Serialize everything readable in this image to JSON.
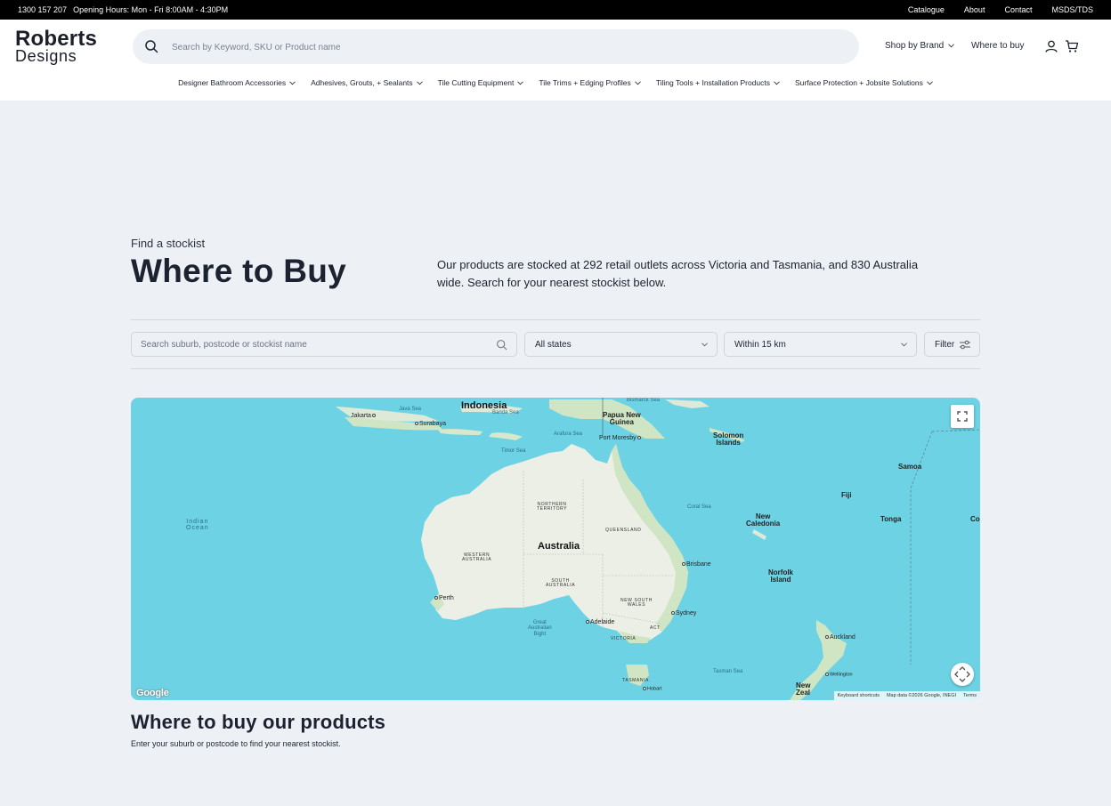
{
  "topbar": {
    "phone": "1300 157 207",
    "hours": "Opening Hours: Mon - Fri 8:00AM - 4:30PM",
    "links": [
      "Catalogue",
      "About",
      "Contact",
      "MSDS/TDS"
    ]
  },
  "header": {
    "logo_line1": "Roberts",
    "logo_line2": "Designs",
    "search_placeholder": "Search by Keyword, SKU or Product name",
    "shop_by_brand": "Shop by Brand",
    "where_to_buy": "Where to buy",
    "categories": [
      "Designer Bathroom Accessories",
      "Adhesives, Grouts, + Sealants",
      "Tile Cutting Equipment",
      "Tile Trims + Edging Profiles",
      "Tiling Tools + Installation Products",
      "Surface Protection + Jobsite Solutions"
    ]
  },
  "hero": {
    "eyebrow": "Find a stockist",
    "title": "Where to Buy",
    "intro": "Our products are stocked at 292 retail outlets across Victoria and Tasmania, and 830 Australia wide. Search for your nearest stockist below."
  },
  "filters": {
    "search_placeholder": "Search suburb, postcode or stockist name",
    "state": "All states",
    "radius": "Within 15 km",
    "filter_label": "Filter"
  },
  "map": {
    "labels": {
      "indonesia": "Indonesia",
      "jakarta": "Jakarta",
      "java_sea": "Java Sea",
      "banda_sea": "Banda Sea",
      "surabaya": "Surabaya",
      "bismarck": "Bismarck Sea",
      "png": "Papua New\nGuinea",
      "port_moresby": "Port Moresby",
      "arafura": "Arafura Sea",
      "timor": "Timor Sea",
      "solomon": "Solomon\nIslands",
      "samoa": "Samoa",
      "fiji": "Fiji",
      "tonga": "Tonga",
      "co": "Co",
      "new_caledonia": "New\nCaledonia",
      "coral_sea": "Coral Sea",
      "indian_ocean": "Indian\nOcean",
      "northern_territory": "NORTHERN\nTERRITORY",
      "queensland": "QUEENSLAND",
      "australia": "Australia",
      "western_australia": "WESTERN\nAUSTRALIA",
      "south_australia": "SOUTH\nAUSTRALIA",
      "brisbane": "Brisbane",
      "norfolk": "Norfolk\nIsland",
      "perth": "Perth",
      "nsw": "NEW SOUTH\nWALES",
      "sydney": "Sydney",
      "adelaide": "Adelaide",
      "gab": "Great\nAustralian\nBight",
      "act": "ACT",
      "victoria": "VICTORIA",
      "auckland": "Auckland",
      "tasman": "Tasman Sea",
      "wellington": "Wellington",
      "tasmania": "TASMANIA",
      "hobart": "Hobart",
      "nz": "New\nZeal"
    },
    "google": "Google",
    "attribution": [
      "Keyboard shortcuts",
      "Map data ©2026 Google, INEGI",
      "Terms"
    ]
  },
  "section": {
    "title": "Where to buy our products",
    "subtitle": "Enter your suburb or postcode to find your nearest stockist."
  }
}
